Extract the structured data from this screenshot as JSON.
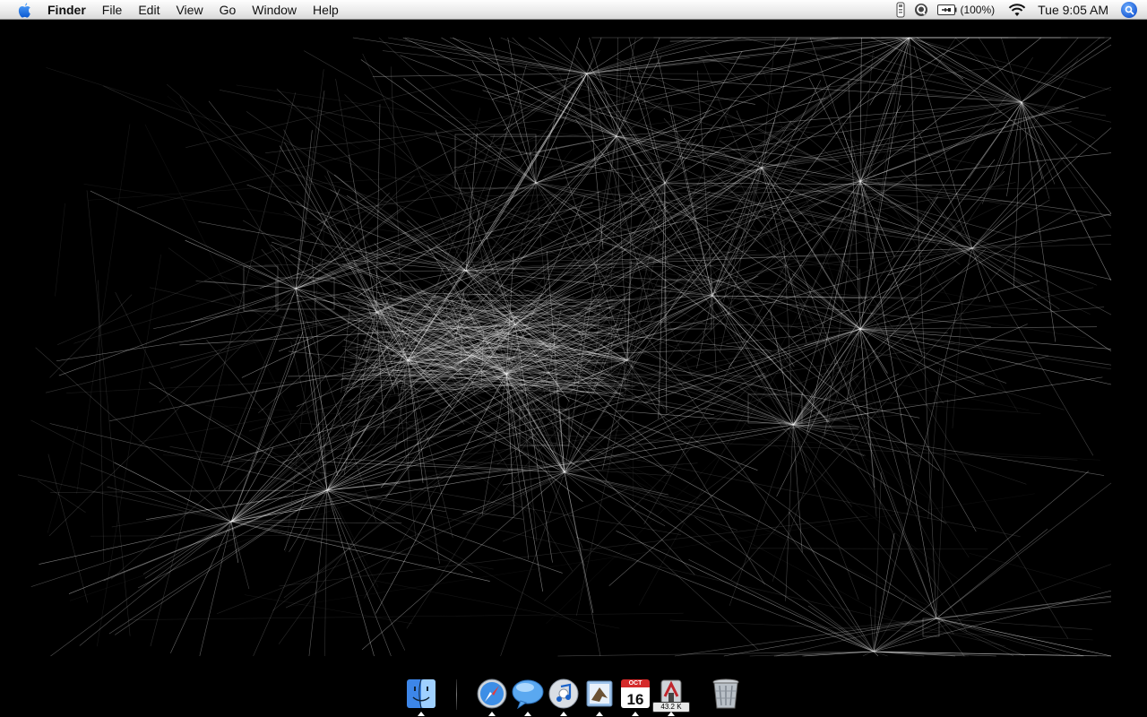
{
  "menubar": {
    "app_name": "Finder",
    "menus": [
      "File",
      "Edit",
      "View",
      "Go",
      "Window",
      "Help"
    ],
    "status": {
      "battery_percent": "(100%)",
      "clock": "Tue 9:05 AM"
    },
    "icons": [
      "apple-icon",
      "airport-status-icon",
      "quicktime-icon",
      "battery-icon",
      "wifi-icon",
      "spotlight-icon"
    ]
  },
  "dock": {
    "items": [
      {
        "name": "Finder",
        "icon": "finder-icon",
        "running": true
      },
      {
        "name": "Safari",
        "icon": "safari-icon",
        "running": true
      },
      {
        "name": "iChat",
        "icon": "ichat-icon",
        "running": true
      },
      {
        "name": "iTunes",
        "icon": "itunes-icon",
        "running": true
      },
      {
        "name": "Mail",
        "icon": "mail-icon",
        "running": true
      },
      {
        "name": "iCal",
        "icon": "ical-icon",
        "running": true,
        "month": "OCT",
        "day": "16"
      },
      {
        "name": "Activity Monitor",
        "icon": "activity-monitor-icon",
        "running": true,
        "label": "43.2 K"
      },
      {
        "name": "Trash",
        "icon": "trash-icon",
        "running": false
      }
    ]
  },
  "wallpaper": {
    "description_color": "#000000",
    "line_color": "#ffffff"
  }
}
